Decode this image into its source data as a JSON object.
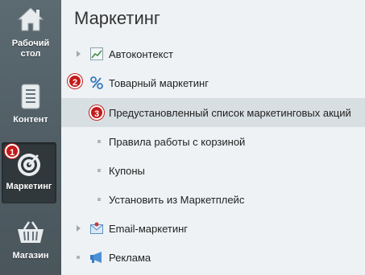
{
  "sidebar": {
    "items": [
      {
        "label_line1": "Рабочий",
        "label_line2": "стол",
        "icon": "home-icon"
      },
      {
        "label_line1": "Контент",
        "icon": "document-icon"
      },
      {
        "label_line1": "Маркетинг",
        "icon": "target-icon",
        "badge": "1",
        "active": true
      },
      {
        "label_line1": "Магазин",
        "icon": "basket-icon"
      }
    ]
  },
  "main": {
    "title": "Маркетинг",
    "items": [
      {
        "label": "Автоконтекст",
        "icon": "chart-icon"
      },
      {
        "label": "Товарный маркетинг",
        "icon": "percent-icon",
        "badge": "2"
      },
      {
        "label": "Предустановленный список маркетинговых акций",
        "badge": "3",
        "selected": true
      },
      {
        "label": "Правила работы с корзиной"
      },
      {
        "label": "Купоны"
      },
      {
        "label": "Установить из Маркетплейс"
      },
      {
        "label": "Email-маркетинг",
        "icon": "email-icon"
      },
      {
        "label": "Реклама",
        "icon": "megaphone-icon"
      }
    ]
  },
  "colors": {
    "badge": "#c41a1a",
    "sidebar": "#55626a",
    "selected_row": "#d8dfe2"
  }
}
